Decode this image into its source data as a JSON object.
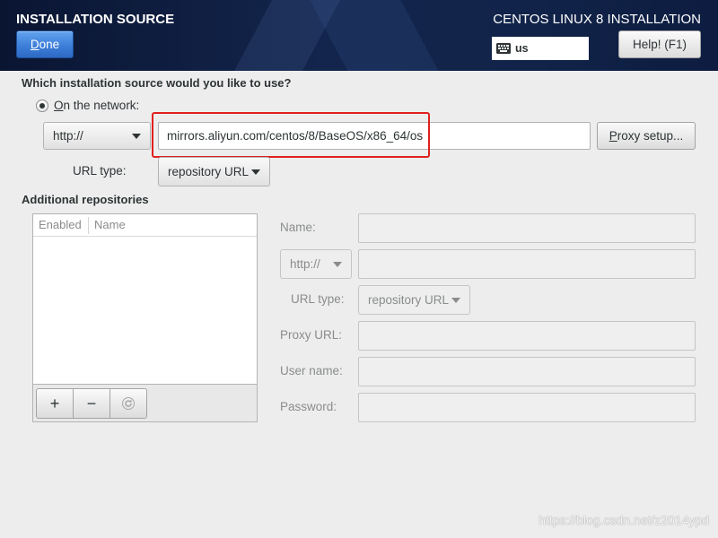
{
  "colors": {
    "header_bg": "#13254c",
    "body_bg": "#ededed",
    "done_button": "#3d7fda",
    "highlight": "#e0201e",
    "disabled_text": "#8a8c8c"
  },
  "icons": {
    "keyboard": "keyboard-icon",
    "dropdown": "chevron-down-icon",
    "radio": "radio-button",
    "refresh": "refresh-icon"
  },
  "header": {
    "title": "INSTALLATION SOURCE",
    "done_label": "Done",
    "product_title": "CENTOS LINUX 8 INSTALLATION",
    "keyboard_layout": "us",
    "help_label": "Help! (F1)"
  },
  "source": {
    "question": "Which installation source would you like to use?",
    "options": [
      {
        "label": "On the network:",
        "selected": true
      }
    ],
    "protocol": "http://",
    "url_value": "mirrors.aliyun.com/centos/8/BaseOS/x86_64/os",
    "proxy_button": "Proxy setup...",
    "url_type_label": "URL type:",
    "url_type_value": "repository URL"
  },
  "additional_repositories": {
    "title": "Additional repositories",
    "columns": [
      "Enabled",
      "Name"
    ],
    "rows": [],
    "toolbar": {
      "add_label": "+",
      "remove_label": "−",
      "refresh_icon": "refresh-icon"
    },
    "form": {
      "enabled": false,
      "name_label": "Name:",
      "protocol": "http://",
      "url_type_label": "URL type:",
      "url_type_value": "repository URL",
      "proxy_url_label": "Proxy URL:",
      "user_name_label": "User name:",
      "password_label": "Password:"
    }
  },
  "watermark": "https://blog.csdn.net/z2014ypd"
}
